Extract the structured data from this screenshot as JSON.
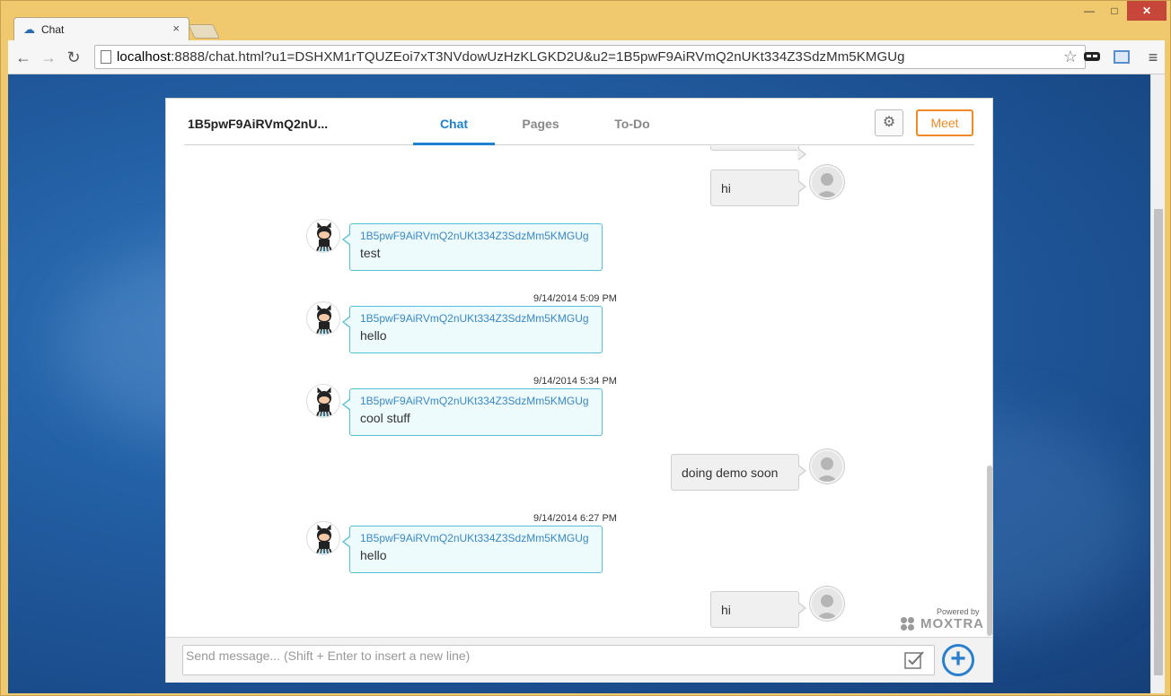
{
  "browser": {
    "tab_title": "Chat",
    "tab_close": "×",
    "window_controls": {
      "minimize": "—",
      "maximize": "□",
      "close": "✕"
    },
    "url_host": "localhost",
    "url_rest": ":8888/chat.html?u1=DSHXM1rTQUZEoi7xT3NVdowUzHzKLGKD2U&u2=1B5pwF9AiRVmQ2nUKt334Z3SdzMm5KMGUg",
    "nav": {
      "back": "←",
      "forward": "→",
      "reload": "↻",
      "star": "☆",
      "menu": "≡"
    }
  },
  "chat": {
    "peer_name": "1B5pwF9AiRVmQ2nU...",
    "tabs": [
      {
        "label": "Chat",
        "active": true
      },
      {
        "label": "Pages",
        "active": false
      },
      {
        "label": "To-Do",
        "active": false
      }
    ],
    "settings_icon": "⚙",
    "meet_label": "Meet",
    "messages": [
      {
        "direction": "out",
        "text": "hi"
      },
      {
        "direction": "in",
        "sender": "1B5pwF9AiRVmQ2nUKt334Z3SdzMm5KMGUg",
        "text": "test"
      },
      {
        "timestamp": "9/14/2014 5:09 PM",
        "direction": "in",
        "sender": "1B5pwF9AiRVmQ2nUKt334Z3SdzMm5KMGUg",
        "text": "hello"
      },
      {
        "timestamp": "9/14/2014 5:34 PM",
        "direction": "in",
        "sender": "1B5pwF9AiRVmQ2nUKt334Z3SdzMm5KMGUg",
        "text": "cool stuff"
      },
      {
        "direction": "out",
        "text": "doing demo soon"
      },
      {
        "timestamp": "9/14/2014 6:27 PM",
        "direction": "in",
        "sender": "1B5pwF9AiRVmQ2nUKt334Z3SdzMm5KMGUg",
        "text": "hello"
      },
      {
        "direction": "out",
        "text": "hi"
      }
    ],
    "powered_by": "Powered by",
    "brand": "MOXTRA",
    "composer": {
      "placeholder": "Send message... (Shift + Enter to insert a new line)",
      "add_icon": "+"
    }
  },
  "colors": {
    "accent": "#1d82d0",
    "meet": "#f08a24",
    "incoming_border": "#55bfd3",
    "sender_name": "#3a88c4"
  }
}
